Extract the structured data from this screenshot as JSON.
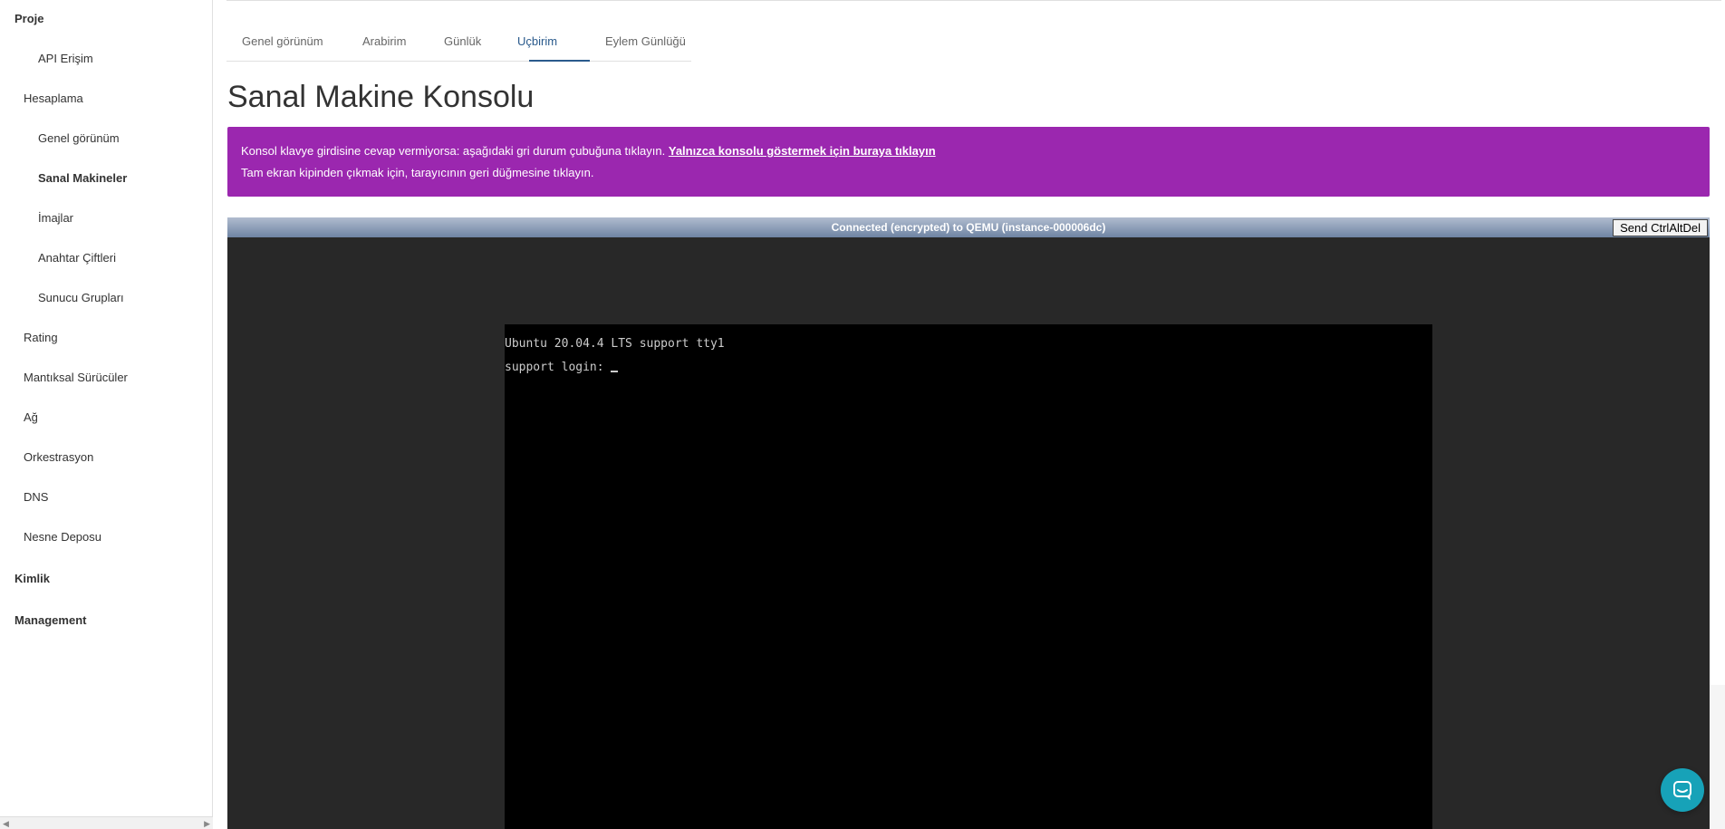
{
  "sidebar": {
    "items": [
      {
        "label": "Proje"
      },
      {
        "label": "API Erişim"
      },
      {
        "label": "Hesaplama"
      },
      {
        "label": "Genel görünüm"
      },
      {
        "label": "Sanal Makineler"
      },
      {
        "label": "İmajlar"
      },
      {
        "label": "Anahtar Çiftleri"
      },
      {
        "label": "Sunucu Grupları"
      },
      {
        "label": "Rating"
      },
      {
        "label": "Mantıksal Sürücüler"
      },
      {
        "label": "Ağ"
      },
      {
        "label": "Orkestrasyon"
      },
      {
        "label": "DNS"
      },
      {
        "label": "Nesne Deposu"
      },
      {
        "label": "Kimlik"
      },
      {
        "label": "Management"
      }
    ],
    "active": "Sanal Makineler"
  },
  "tabs": [
    {
      "label": "Genel görünüm"
    },
    {
      "label": "Arabirim"
    },
    {
      "label": "Günlük"
    },
    {
      "label": "Uçbirim"
    },
    {
      "label": "Eylem Günlüğü"
    }
  ],
  "active_tab": "Uçbirim",
  "page": {
    "title": "Sanal Makine Konsolu"
  },
  "alert": {
    "line1": "Konsol klavye girdisine cevap vermiyorsa: aşağıdaki gri durum çubuğuna tıklayın.",
    "link": "Yalnızca konsolu göstermek için buraya tıklayın",
    "line2": "Tam ekran kipinden çıkmak için, tarayıcının geri düğmesine tıklayın."
  },
  "console": {
    "status": "Connected (encrypted) to QEMU (instance-000006dc)",
    "cad_button": "Send CtrlAltDel",
    "lines": [
      "Ubuntu 20.04.4 LTS support tty1",
      "support login: "
    ]
  },
  "colors": {
    "alert_bg": "#9b27af",
    "accent": "#2a5a8c",
    "chat_bg": "#17a2b8"
  },
  "icons": {
    "chat": "chat-icon",
    "scroll_left": "arrow-left-icon",
    "scroll_right": "arrow-right-icon"
  }
}
